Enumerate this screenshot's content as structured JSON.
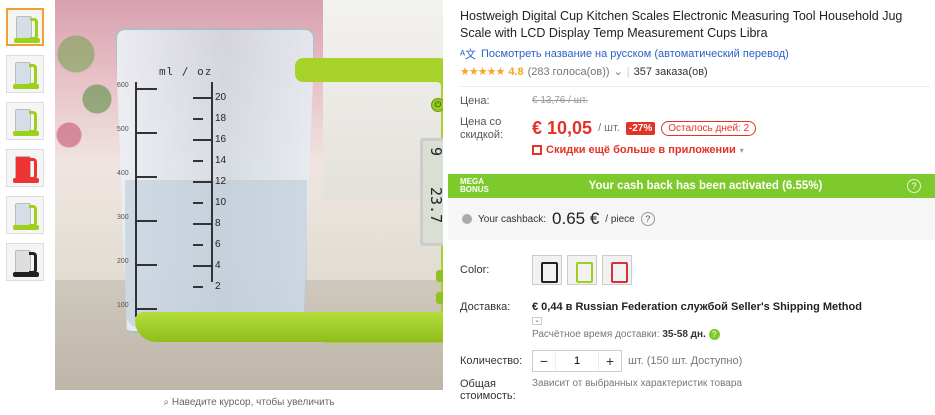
{
  "gallery": {
    "zoom_hint": "Наведите курсор, чтобы увеличить",
    "cup_label": "ml / oz",
    "scale_left": [
      "600",
      "500",
      "400",
      "300",
      "200",
      "100"
    ],
    "scale_right": [
      "20",
      "18",
      "16",
      "14",
      "12",
      "10",
      "8",
      "6",
      "4",
      "2"
    ],
    "lcd_top": "9",
    "lcd_bottom": "23.7"
  },
  "product": {
    "title": "Hostweigh Digital Cup Kitchen Scales Electronic Measuring Tool Household Jug Scale with LCD Display Temp Measurement Cups Libra",
    "translate_link": "Посмотреть название на русском (автоматический перевод)",
    "rating": "4.8",
    "votes": "(283 голоса(ов))",
    "orders": "357 заказа(ов)"
  },
  "price": {
    "label_price": "Цена:",
    "old_price": "€ 13,76 / шт.",
    "label_discount": "Цена со скидкой:",
    "new_price": "€ 10,05",
    "unit": "/ шт.",
    "discount": "-27%",
    "days_left": "Осталось дней: 2",
    "app_promo": "Скидки ещё больше в приложении"
  },
  "bonus": {
    "badge_top": "MEGA",
    "badge_bottom": "BONUS",
    "text": "Your cash back has been activated (6.55%)",
    "cashback_label": "Your cashback:",
    "cashback_value": "0.65 €",
    "cashback_unit": "/ piece"
  },
  "options": {
    "color_label": "Color:",
    "shipping_label": "Доставка:",
    "shipping_price": "€ 0,44",
    "shipping_in": "в",
    "shipping_country": "Russian Federation",
    "shipping_via": "службой",
    "shipping_method": "Seller's Shipping Method",
    "delivery_label": "Расчётное время доставки:",
    "delivery_days": "35-58 дн.",
    "qty_label": "Количество:",
    "qty_value": "1",
    "qty_avail": "шт. (150 шт. Доступно)",
    "total_label": "Общая стоимость:",
    "total_value": "Зависит от выбранных характеристик товара"
  },
  "colors": {
    "accent": "#e43225",
    "bonus": "#7ec92b",
    "brand_green": "#a7d22a"
  }
}
